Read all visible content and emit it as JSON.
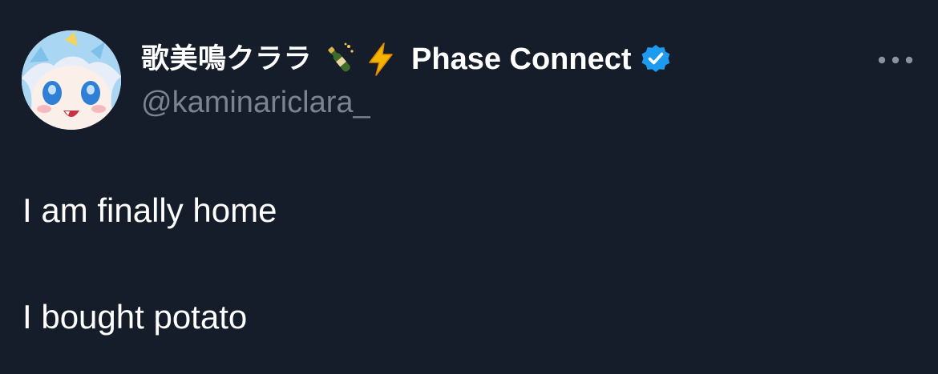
{
  "tweet": {
    "display_name": "歌美鳴クララ",
    "name_emojis": [
      "champagne-bottle-emoji",
      "lightning-emoji"
    ],
    "org_name": "Phase Connect",
    "handle": "@kaminariclara_",
    "text_lines": [
      "I am finally home",
      "I bought potato"
    ]
  },
  "colors": {
    "background": "#161d2a",
    "handle_gray": "#7b838f",
    "verified_blue": "#1d9bf0"
  }
}
